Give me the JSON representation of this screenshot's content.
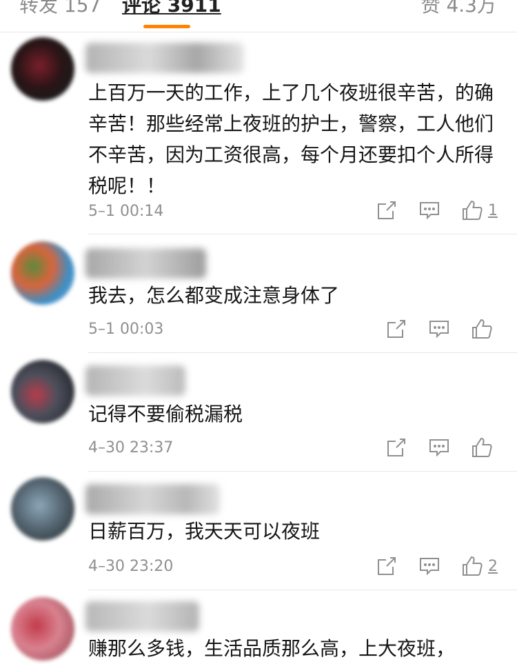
{
  "tabs": {
    "repost": "转发 157",
    "comments": "评论 3911",
    "likes": "赞 4.3万"
  },
  "colors": {
    "accent": "#ff8200",
    "meta": "#8f8f8f"
  },
  "comments": [
    {
      "text": "上百万一天的工作，上了几个夜班很辛苦，的确辛苦！那些经常上夜班的护士，警察，工人他们不辛苦，因为工资很高，每个月还要扣个人所得税呢！！",
      "time": "5–1 00:14",
      "likes": "1"
    },
    {
      "text": "我去，怎么都变成注意身体了",
      "time": "5–1 00:03",
      "likes": ""
    },
    {
      "text": "记得不要偷税漏税",
      "time": "4–30 23:37",
      "likes": ""
    },
    {
      "text": "日薪百万，我天天可以夜班",
      "time": "4–30 23:20",
      "likes": "2"
    },
    {
      "text": "赚那么多钱，生活品质那么高，上大夜班，",
      "time": "",
      "likes": ""
    }
  ],
  "icons": [
    "share-icon",
    "reply-icon",
    "thumbs-up-icon"
  ]
}
